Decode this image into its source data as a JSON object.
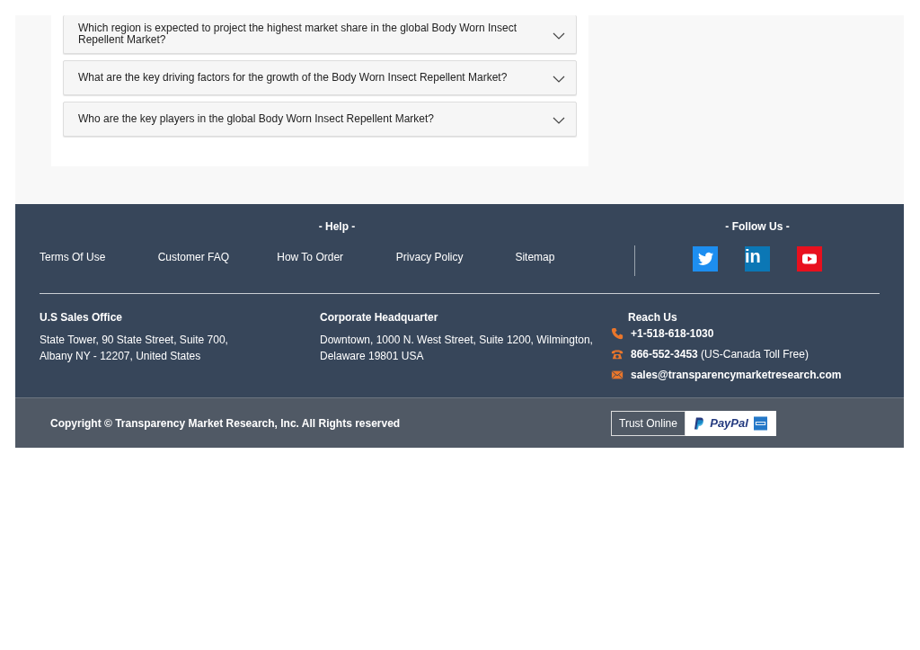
{
  "faq": [
    {
      "question": "Which region is expected to project the highest market share in the global Body Worn Insect Repellent Market?",
      "expanded": false
    },
    {
      "question": "What are the key driving factors for the growth of the Body Worn Insect Repellent Market?",
      "expanded": false
    },
    {
      "question": "Who are the key players in the global Body Worn Insect Repellent Market?",
      "expanded": false
    }
  ],
  "footer": {
    "help_heading": "- Help -",
    "help_links": [
      "Terms Of Use",
      "Customer FAQ",
      "How To Order",
      "Privacy Policy",
      "Sitemap"
    ],
    "follow_heading": "- Follow Us -",
    "social": [
      {
        "kind": "twitter",
        "color": "#1d8ef0"
      },
      {
        "kind": "linkedin",
        "color": "#0b77b5",
        "label": "in"
      },
      {
        "kind": "youtube",
        "color": "#e8101e"
      }
    ],
    "offices": [
      {
        "heading": "U.S Sales Office",
        "lines": [
          "State Tower, 90 State Street, Suite 700,",
          "Albany NY - 12207, United States"
        ]
      },
      {
        "heading": "Corporate Headquarter",
        "lines": [
          "Downtown, 1000 N. West Street, Suite 1200, Wilmington,",
          "Delaware 19801 USA"
        ]
      }
    ],
    "reach_heading": "Reach Us",
    "contacts": [
      {
        "kind": "phone",
        "text": "**+1-518-618-1030**"
      },
      {
        "kind": "telephone",
        "text": "**866-552-3453** (US-Canada Toll Free)"
      },
      {
        "kind": "email",
        "text": "**sales@transparencymarketresearch.com**"
      }
    ],
    "copyright": "Copyright © Transparency Market Research, Inc. All Rights reserved",
    "trust_label": "Trust Online",
    "paypal_label": "PayPal"
  }
}
